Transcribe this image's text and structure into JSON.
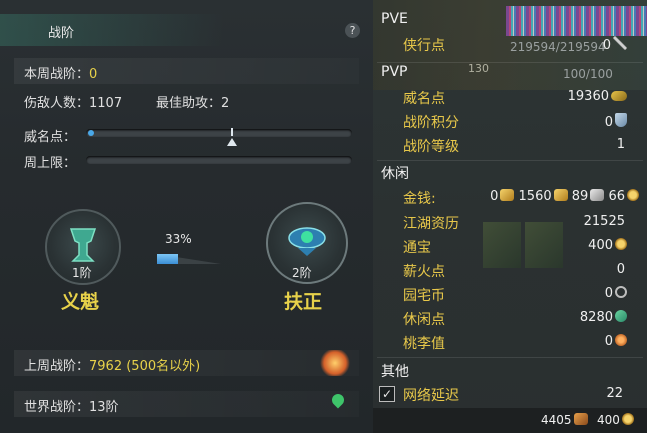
{
  "left_panel": {
    "title": "战阶",
    "help": "?",
    "weekly_rank_label": "本周战阶：",
    "weekly_rank_value": "0",
    "kills_label": "伤敌人数：1107",
    "assist_label": "最佳助攻：2",
    "prestige_label": "威名点：",
    "prestige_progress": 0.01,
    "weekly_cap_label": "周上限：",
    "weekly_cap_progress": 0,
    "progress_percent_text": "33%",
    "progress_fraction": 0.33,
    "current_rank": {
      "level": "1阶",
      "name": "义魁"
    },
    "next_rank": {
      "level": "2阶",
      "name": "扶正"
    },
    "last_week_label": "上周战阶：",
    "last_week_value": "7962 (500名以外)",
    "world_rank_label": "世界战阶：13阶"
  },
  "right_panel": {
    "top_fragment": "219594/219594",
    "top_fragment_2": "130",
    "top_fragment_3": "100/100",
    "pve": {
      "header": "PVE",
      "items": [
        {
          "label": "侠行点",
          "value": "0",
          "icon": "sword-icon"
        }
      ]
    },
    "pvp": {
      "header": "PVP",
      "items": [
        {
          "label": "威名点",
          "value": "19360",
          "icon": "mask-icon"
        },
        {
          "label": "战阶积分",
          "value": "0",
          "icon": "crest-icon"
        },
        {
          "label": "战阶等级",
          "value": "1",
          "icon": ""
        }
      ]
    },
    "leisure": {
      "header": "休闲",
      "money_label": "金钱:",
      "money_values": [
        "0",
        "1560",
        "89",
        "66"
      ],
      "items": [
        {
          "label": "江湖资历",
          "value": "21525",
          "icon": ""
        },
        {
          "label": "通宝",
          "value": "400",
          "icon": "coin-icon"
        },
        {
          "label": "薪火点",
          "value": "0",
          "icon": ""
        },
        {
          "label": "园宅币",
          "value": "0",
          "icon": "g-icon"
        },
        {
          "label": "休闲点",
          "value": "8280",
          "icon": "leaf-icon"
        },
        {
          "label": "桃李值",
          "value": "0",
          "icon": "peach-icon"
        }
      ]
    },
    "other": {
      "header": "其他",
      "latency_label": "网络延迟",
      "latency_value": "22",
      "latency_checked": true
    },
    "bottom": {
      "value_a": "4405",
      "value_b": "400"
    }
  }
}
